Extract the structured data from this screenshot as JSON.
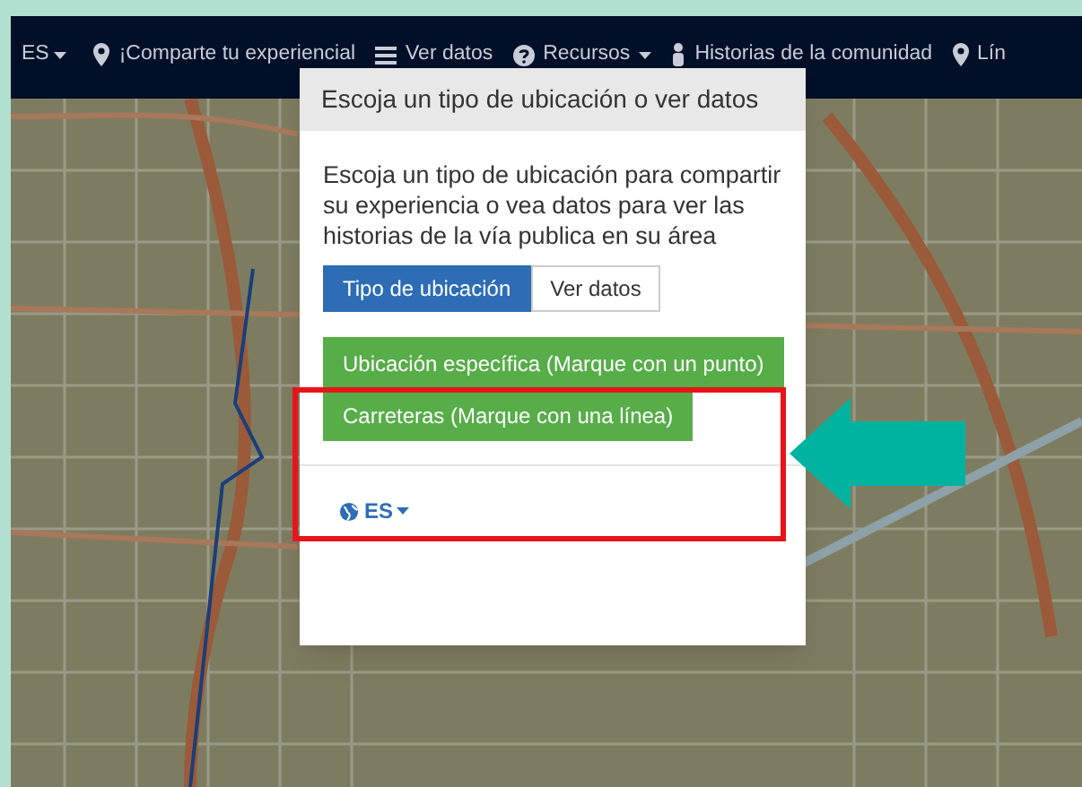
{
  "navbar": {
    "language": "ES",
    "items": [
      {
        "label": "¡Comparte tu experiencial",
        "caret": false
      },
      {
        "label": "Ver datos",
        "caret": false
      },
      {
        "label": "Recursos",
        "caret": true
      },
      {
        "label": "Historias de la comunidad",
        "caret": false
      },
      {
        "label": "Lín",
        "caret": false
      }
    ]
  },
  "modal": {
    "title": "Escoja un tipo de ubicación o ver datos",
    "description": "Escoja un tipo de ubicación para compartir su experiencia o vea datos para ver las historias de la vía publica en su área",
    "tabs": [
      {
        "label": "Tipo de ubicación",
        "selected": true
      },
      {
        "label": "Ver datos",
        "selected": false
      }
    ],
    "options": [
      "Ubicación específica (Marque con un punto)",
      "Carreteras (Marque con una línea)"
    ],
    "footer_language": "ES"
  }
}
